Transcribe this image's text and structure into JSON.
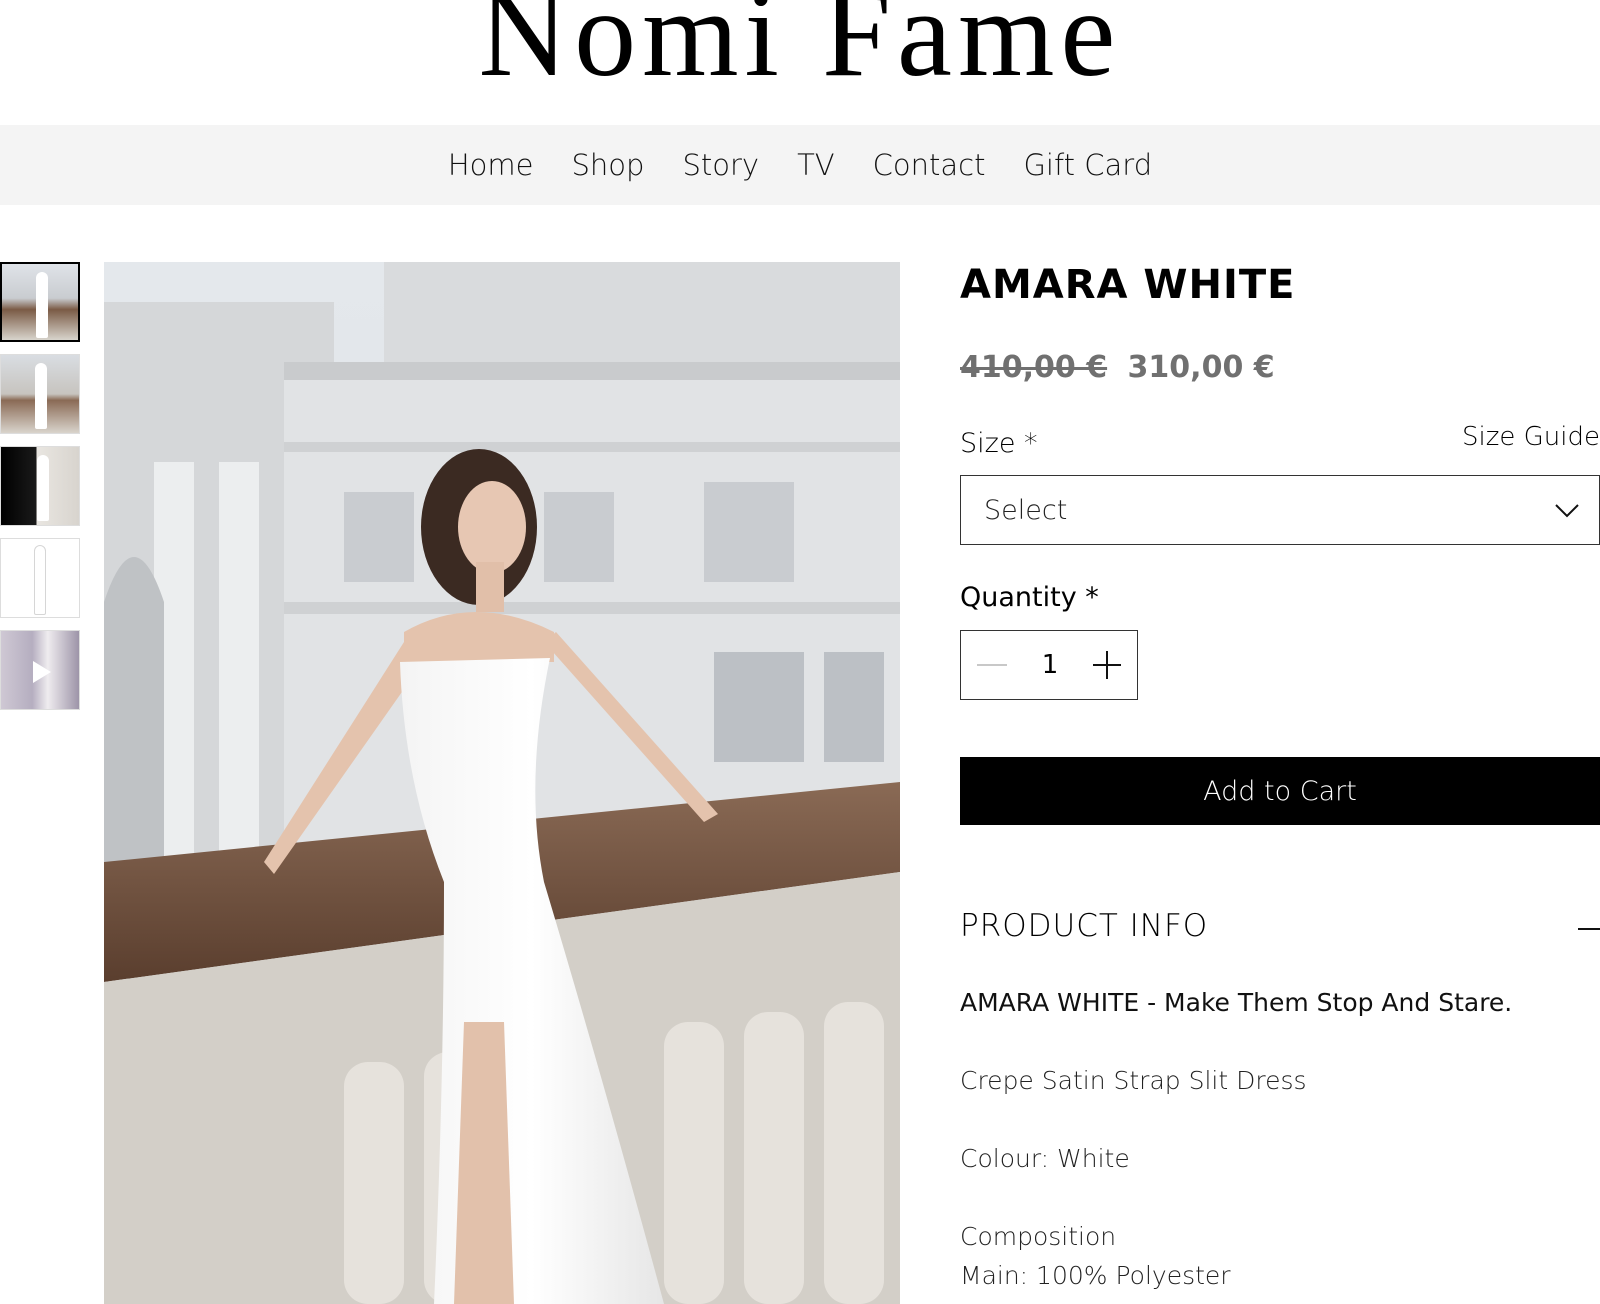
{
  "brand": {
    "name": "Nomi Fame"
  },
  "nav": {
    "items": [
      {
        "label": "Home"
      },
      {
        "label": "Shop"
      },
      {
        "label": "Story"
      },
      {
        "label": "TV"
      },
      {
        "label": "Contact"
      },
      {
        "label": "Gift Card"
      }
    ],
    "background": "#f4f4f4"
  },
  "gallery": {
    "thumbnail_count": 5,
    "selected_index": 0,
    "last_thumbnail_icon": "play-icon"
  },
  "product": {
    "title": "AMARA WHITE",
    "old_price": "410,00 €",
    "price": "310,00 €",
    "size_label": "Size *",
    "size_guide": "Size Guide",
    "size_select_value": "Select",
    "quantity_label": "Quantity *",
    "quantity_value": "1",
    "add_to_cart": "Add to Cart",
    "info_title": "PRODUCT INFO",
    "info_headline": "AMARA WHITE - Make Them Stop And Stare.",
    "info_lines": [
      "Crepe Satin Strap Slit Dress",
      "Colour: White",
      "Composition",
      "Main: 100% Polyester"
    ]
  },
  "colors": {
    "button_bg": "#000000",
    "price_gray": "#707070"
  }
}
